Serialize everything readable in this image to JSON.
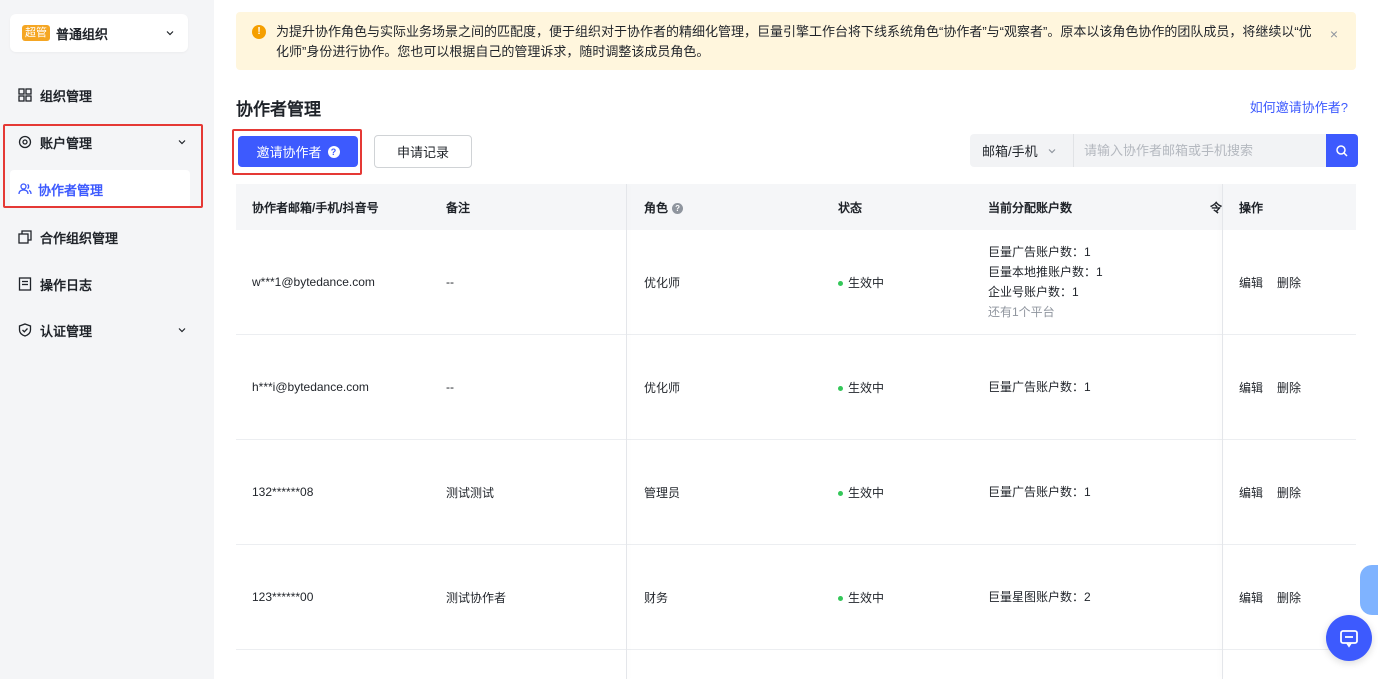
{
  "sidebar": {
    "org_badge": "超管",
    "org_name": "普通组织",
    "items": [
      {
        "label": "组织管理",
        "icon": "grid-icon"
      },
      {
        "label": "账户管理",
        "icon": "gear-icon"
      },
      {
        "label": "协作者管理",
        "icon": "users-icon"
      },
      {
        "label": "合作组织管理",
        "icon": "copy-icon"
      },
      {
        "label": "操作日志",
        "icon": "log-icon"
      },
      {
        "label": "认证管理",
        "icon": "shield-check-icon"
      }
    ]
  },
  "notice": {
    "text": "为提升协作角色与实际业务场景之间的匹配度，便于组织对于协作者的精细化管理，巨量引擎工作台将下线系统角色“协作者”与“观察者”。原本以该角色协作的团队成员，将继续以“优化师”身份进行协作。您也可以根据自己的管理诉求，随时调整该成员角色。",
    "close": "×"
  },
  "page": {
    "title": "协作者管理",
    "help_link": "如何邀请协作者?"
  },
  "toolbar": {
    "invite_label": "邀请协作者",
    "records_label": "申请记录"
  },
  "search": {
    "select_value": "邮箱/手机",
    "placeholder": "请输入协作者邮箱或手机搜索"
  },
  "table": {
    "headers": {
      "contact": "协作者邮箱/手机/抖音号",
      "remark": "备注",
      "role": "角色",
      "status": "状态",
      "accounts": "当前分配账户数",
      "truncated": "令",
      "actions": "操作"
    },
    "rows": [
      {
        "contact": "w***1@bytedance.com",
        "remark": "--",
        "role": "优化师",
        "status": "生效中",
        "accounts": [
          "巨量广告账户数：1",
          "巨量本地推账户数：1",
          "企业号账户数：1"
        ],
        "more": "还有1个平台",
        "edit": "编辑",
        "delete": "删除"
      },
      {
        "contact": "h***i@bytedance.com",
        "remark": "--",
        "role": "优化师",
        "status": "生效中",
        "accounts": [
          "巨量广告账户数：1"
        ],
        "more": "",
        "edit": "编辑",
        "delete": "删除"
      },
      {
        "contact": "132******08",
        "remark": "测试测试",
        "role": "管理员",
        "status": "生效中",
        "accounts": [
          "巨量广告账户数：1"
        ],
        "more": "",
        "edit": "编辑",
        "delete": "删除"
      },
      {
        "contact": "123******00",
        "remark": "测试协作者",
        "role": "财务",
        "status": "生效中",
        "accounts": [
          "巨量星图账户数：2"
        ],
        "more": "",
        "edit": "编辑",
        "delete": "删除"
      }
    ]
  },
  "colors": {
    "primary": "#3d5afe",
    "highlight_border": "#e53935",
    "status_active": "#34c759",
    "notice_bg": "#fff6dd"
  }
}
